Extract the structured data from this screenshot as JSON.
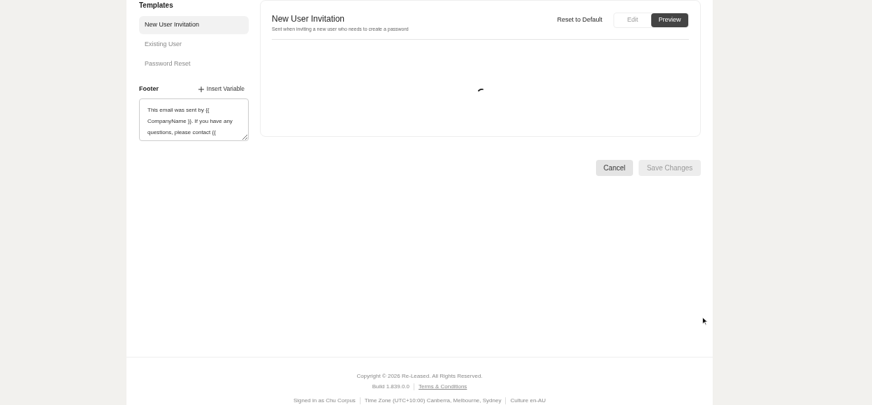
{
  "sidebar": {
    "title": "Templates",
    "items": [
      {
        "label": "New User Invitation",
        "selected": true
      },
      {
        "label": "Existing User",
        "selected": false
      },
      {
        "label": "Password Reset",
        "selected": false
      }
    ]
  },
  "footer_editor": {
    "title": "Footer",
    "insert_variable": "Insert Variable",
    "value": "This email was sent by {{ CompanyName }}. If you have any questions, please contact {{"
  },
  "panel": {
    "title": "New User Invitation",
    "subtitle": "Sent when inviting a new user who needs to create a password",
    "reset": "Reset to Default",
    "modes": [
      {
        "label": "Edit",
        "selected": false
      },
      {
        "label": "Preview",
        "selected": true
      }
    ],
    "loading": true
  },
  "actions": {
    "cancel": "Cancel",
    "save": "Save Changes",
    "save_disabled": true
  },
  "page_footer": {
    "copyright": "Copyright © 2026 Re-Leased. All Rights Reserved.",
    "build": "Build 1.839.0.0",
    "terms": "Terms & Conditions",
    "info": [
      "Signed in as Chu Corpus",
      "Time Zone (UTC+10:00) Canberra, Melbourne, Sydney",
      "Culture en-AU"
    ]
  }
}
